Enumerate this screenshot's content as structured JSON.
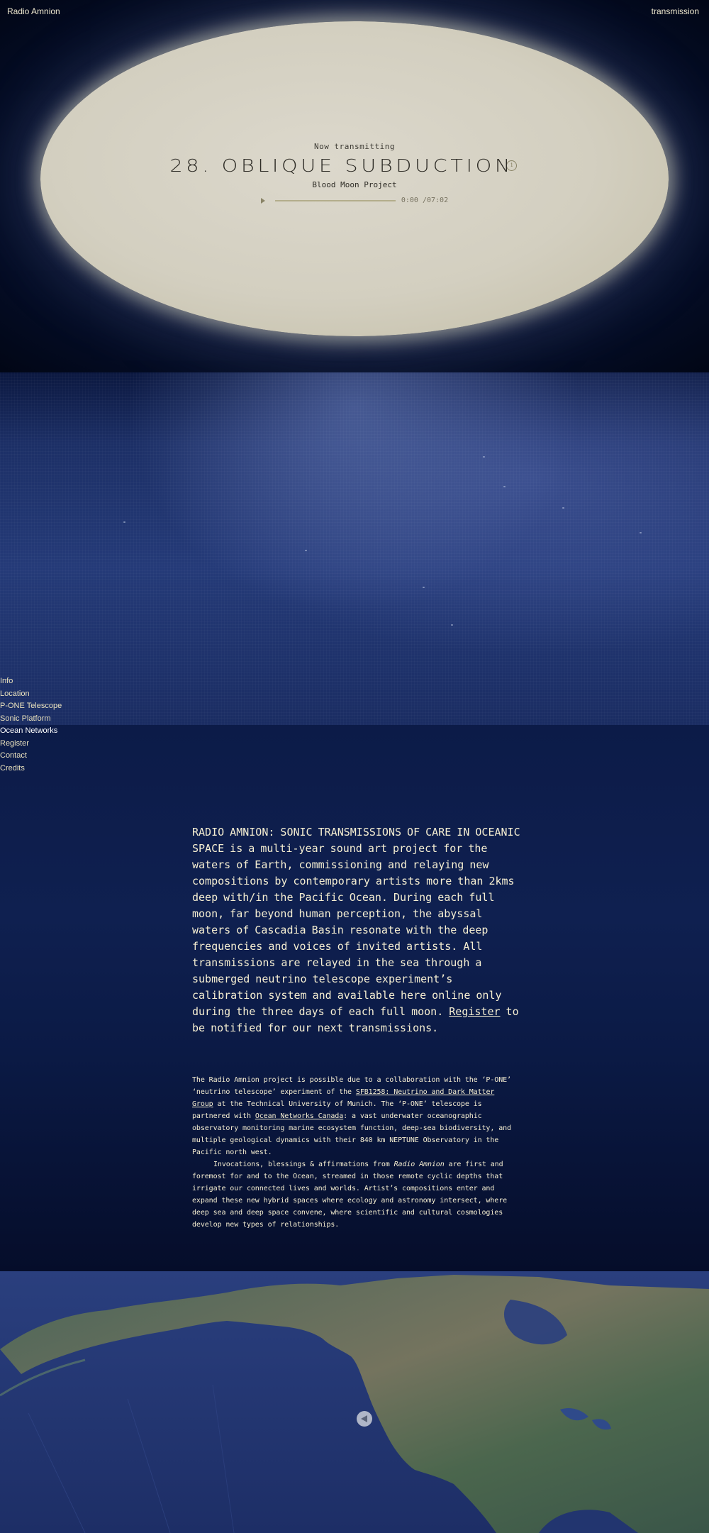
{
  "header": {
    "brand": "Radio Amnion",
    "transmit_label": "transmission"
  },
  "player": {
    "status": "Now transmitting",
    "track_title": "28. OBLIQUE SUBDUCTION",
    "info_icon_glyph": "i",
    "artist": "Blood Moon Project",
    "time": "0:00 /07:02",
    "progress": 0
  },
  "nav": {
    "items": [
      {
        "label": "Info"
      },
      {
        "label": "Location"
      },
      {
        "label": "P-ONE Telescope"
      },
      {
        "label": "Sonic Platform"
      },
      {
        "label": "Ocean Networks"
      },
      {
        "label": "Register"
      },
      {
        "label": "Contact"
      },
      {
        "label": "Credits"
      }
    ]
  },
  "intro": {
    "text": "RADIO AMNION: SONIC TRANSMISSIONS OF CARE IN OCEANIC SPACE is a multi-year sound art project for the waters of Earth, commissioning and relaying new compositions by contemporary artists more than 2kms deep with/in the Pacific Ocean. During each full moon, far beyond human perception, the abyssal waters of Cascadia Basin resonate with the deep frequencies and voices of invited artists. All transmissions are relayed in the sea through a submerged neutrino telescope experiment’s calibration system and available here online only during the three days of each full moon.",
    "register_link": "Register",
    "register_tail": " to be notified for our next transmissions."
  },
  "credits": {
    "p1_a": "The Radio Amnion project is possible due to a collaboration with the ‘P-ONE’ ‘neutrino telescope’ experiment of the ",
    "link_sfb": "SFB1258: Neutrino and Dark Matter Group",
    "p1_b": " at the Technical University of Munich. The ‘P-ONE’ telescope is partnered with ",
    "link_onc": "Ocean Networks Canada",
    "p1_c": ": a vast underwater oceanographic observatory monitoring marine ecosystem function, deep-sea biodiversity, and multiple geological dynamics with their 840 km NEPTUNE Observatory in the Pacific north west.",
    "p2_a": "Invocations, blessings & affirmations from ",
    "p2_em": "Radio Amnion",
    "p2_b": " are first and foremost for and to the Ocean, streamed in those remote cyclic depths that irrigate our connected lives and worlds. Artist’s compositions enter and expand these new hybrid spaces where ecology and astronomy intersect, where deep sea and deep space convene, where scientific and cultural cosmologies develop new types of relationships."
  },
  "colors": {
    "accent_text": "#f6efd2",
    "nav_text": "#e9e1bd",
    "deep_blue": "#071233",
    "moon": "#d6d2c4"
  },
  "icons": {
    "play": "play-icon",
    "info": "info-icon",
    "map_marker": "location-marker-icon"
  }
}
